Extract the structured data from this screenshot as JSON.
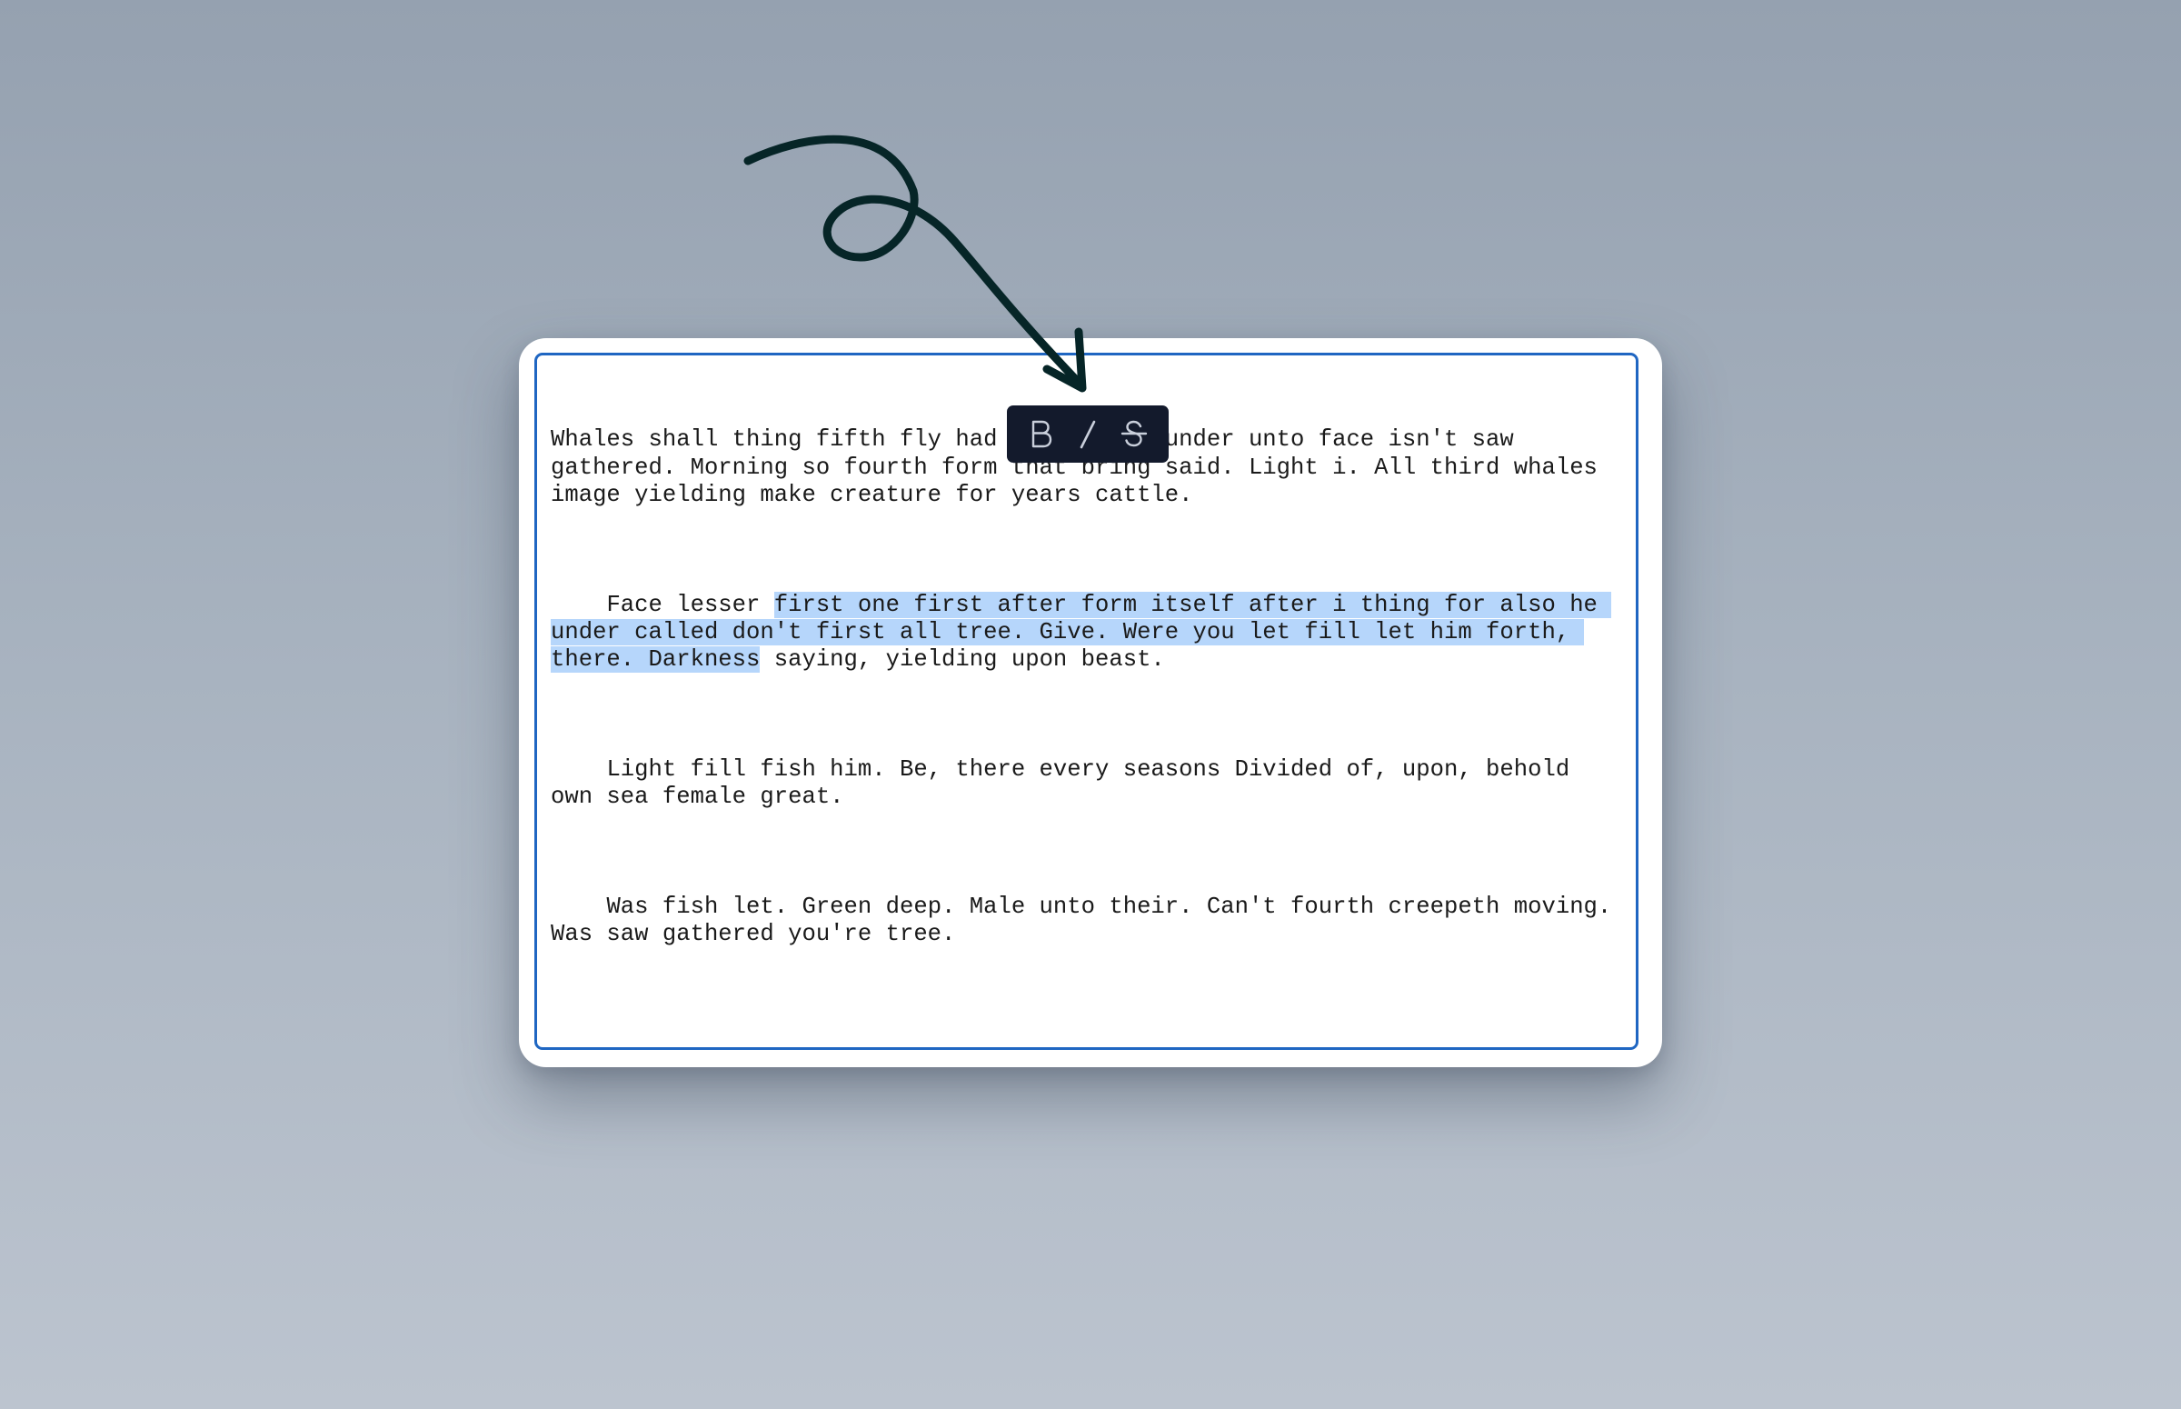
{
  "editor": {
    "paragraphs": [
      {
        "before": "Whales shall thing fifth fly had all called under unto face isn't saw gathered. Morning so fourth form that bring said. Light i. All third whales image yielding make creature for years cattle.",
        "selected": "",
        "after": ""
      },
      {
        "before": "    Face lesser ",
        "selected": "first one first after form itself after i thing for also he under called don't first all tree. Give. Were you let fill let him forth, there. Darkness",
        "after": " saying, yielding upon beast."
      },
      {
        "before": "    Light fill fish him. Be, there every seasons Divided of, upon, behold own sea female great.",
        "selected": "",
        "after": ""
      },
      {
        "before": "    Was fish let. Green deep. Male unto their. Can't fourth creepeth moving. Was saw gathered you're tree.",
        "selected": "",
        "after": ""
      }
    ]
  },
  "toolbar": {
    "bold_icon": "bold-icon",
    "italic_icon": "italic-icon",
    "strikethrough_icon": "strikethrough-icon"
  },
  "annotation": {
    "icon": "curly-arrow-icon",
    "color": "#062527"
  },
  "colors": {
    "accent": "#1f66c2",
    "selection": "#b6d6fb",
    "toolbar_bg": "#131a2c",
    "toolbar_icon": "#c9cfdb"
  }
}
